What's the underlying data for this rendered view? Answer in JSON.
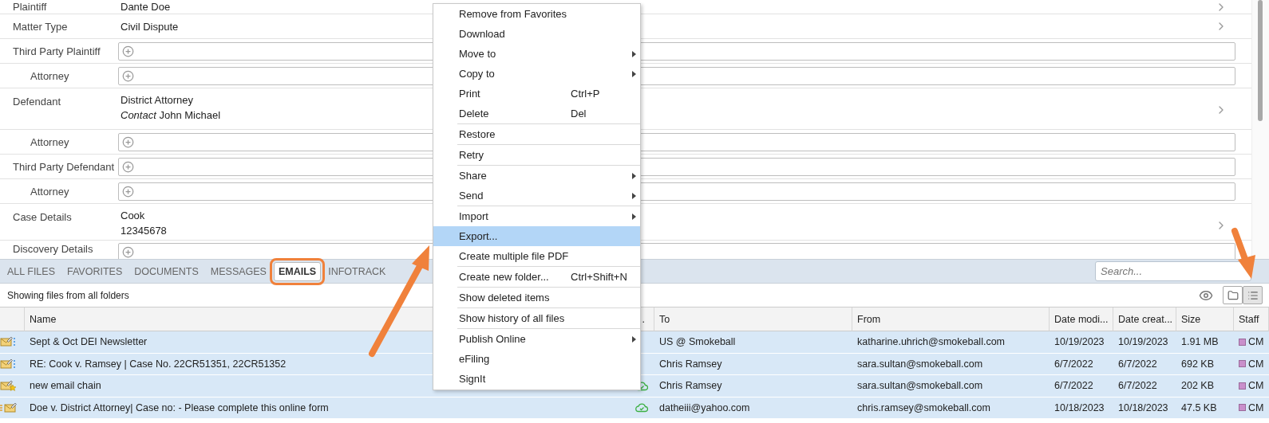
{
  "fields": [
    {
      "label": "Plaintiff",
      "kind": "detail",
      "lines": [
        "Dante Doe"
      ]
    },
    {
      "label": "Matter Type",
      "kind": "detail",
      "lines": [
        "Civil Dispute"
      ]
    },
    {
      "label": "Third Party Plaintiff",
      "kind": "input",
      "children": [
        {
          "label": "Attorney",
          "kind": "input"
        }
      ]
    },
    {
      "label": "Defendant",
      "kind": "detail",
      "lines": [
        "District Attorney",
        "*Contact* John Michael"
      ],
      "children": [
        {
          "label": "Attorney",
          "kind": "input"
        }
      ]
    },
    {
      "label": "Third Party Defendant",
      "kind": "input",
      "children": [
        {
          "label": "Attorney",
          "kind": "input"
        }
      ]
    },
    {
      "label": "Case Details",
      "kind": "detail",
      "lines": [
        "Cook",
        "12345678"
      ]
    },
    {
      "label": "Discovery Details",
      "kind": "input"
    }
  ],
  "tabs": [
    {
      "label": "ALL FILES",
      "selected": false,
      "annotated": false
    },
    {
      "label": "FAVORITES",
      "selected": false,
      "annotated": false
    },
    {
      "label": "DOCUMENTS",
      "selected": false,
      "annotated": false
    },
    {
      "label": "MESSAGES",
      "selected": false,
      "annotated": false
    },
    {
      "label": "EMAILS",
      "selected": true,
      "annotated": true
    },
    {
      "label": "INFOTRACK",
      "selected": false,
      "annotated": false
    }
  ],
  "search": {
    "placeholder": "Search..."
  },
  "info": "Showing files from all folders",
  "views": [
    {
      "kind": "folder",
      "selected": false
    },
    {
      "kind": "list",
      "selected": true
    }
  ],
  "table": {
    "columns": [
      "",
      "Name",
      "…",
      "To",
      "From",
      "Date modi...",
      "Date creat...",
      "Size",
      "Staff"
    ],
    "rows": [
      {
        "kind": "email-list",
        "name": "Sept & Oct DEI Newsletter",
        "synced": false,
        "to": "US @ Smokeball",
        "from": "katharine.uhrich@smokeball.com",
        "modified": "10/19/2023",
        "created": "10/19/2023",
        "size": "1.91 MB",
        "staff": "CM",
        "color": "#c98fcb",
        "selected": true
      },
      {
        "kind": "email-list",
        "name": "RE: Cook v. Ramsey | Case No. 22CR51351, 22CR51352",
        "synced": false,
        "to": "Chris Ramsey",
        "from": "sara.sultan@smokeball.com",
        "modified": "6/7/2022",
        "created": "6/7/2022",
        "size": "692 KB",
        "staff": "CM",
        "color": "#c98fcb",
        "selected": true
      },
      {
        "kind": "email-star",
        "name": "new email chain",
        "synced": true,
        "to": "Chris Ramsey",
        "from": "sara.sultan@smokeball.com",
        "modified": "6/7/2022",
        "created": "6/7/2022",
        "size": "202 KB",
        "staff": "CM",
        "color": "#c98fcb",
        "selected": true
      },
      {
        "kind": "email-lines",
        "name": "Doe v. District Attorney| Case no:  - Please complete this online form",
        "synced": true,
        "to": "datheiii@yahoo.com",
        "from": "chris.ramsey@smokeball.com",
        "modified": "10/18/2023",
        "created": "10/18/2023",
        "size": "47.5 KB",
        "staff": "CM",
        "color": "#c98fcb",
        "selected": true
      }
    ]
  },
  "menu": {
    "groups": [
      [
        {
          "label": "Remove from Favorites",
          "submenu": false,
          "selected": false
        },
        {
          "label": "Download",
          "submenu": false,
          "selected": false
        },
        {
          "label": "Move to",
          "submenu": true,
          "selected": false
        },
        {
          "label": "Copy to",
          "submenu": true,
          "selected": false
        },
        {
          "label": "Print",
          "shortcut": "Ctrl+P",
          "submenu": false,
          "selected": false
        },
        {
          "label": "Delete",
          "shortcut": "Del",
          "submenu": false,
          "selected": false
        }
      ],
      [
        {
          "label": "Restore",
          "submenu": false,
          "selected": false
        }
      ],
      [
        {
          "label": "Retry",
          "submenu": false,
          "selected": false
        }
      ],
      [
        {
          "label": "Share",
          "submenu": true,
          "selected": false
        },
        {
          "label": "Send",
          "submenu": true,
          "selected": false
        }
      ],
      [
        {
          "label": "Import",
          "submenu": true,
          "selected": false
        },
        {
          "label": "Export...",
          "submenu": false,
          "selected": true
        },
        {
          "label": "Create multiple file PDF",
          "submenu": false,
          "selected": false
        }
      ],
      [
        {
          "label": "Create new folder...",
          "shortcut": "Ctrl+Shift+N",
          "submenu": false,
          "selected": false
        }
      ],
      [
        {
          "label": "Show deleted items",
          "submenu": false,
          "selected": false
        }
      ],
      [
        {
          "label": "Show history of all files",
          "submenu": false,
          "selected": false
        }
      ],
      [
        {
          "label": "Publish Online",
          "submenu": true,
          "selected": false
        },
        {
          "label": "eFiling",
          "submenu": false,
          "selected": false
        },
        {
          "label": "SignIt",
          "submenu": false,
          "selected": false
        }
      ]
    ]
  }
}
